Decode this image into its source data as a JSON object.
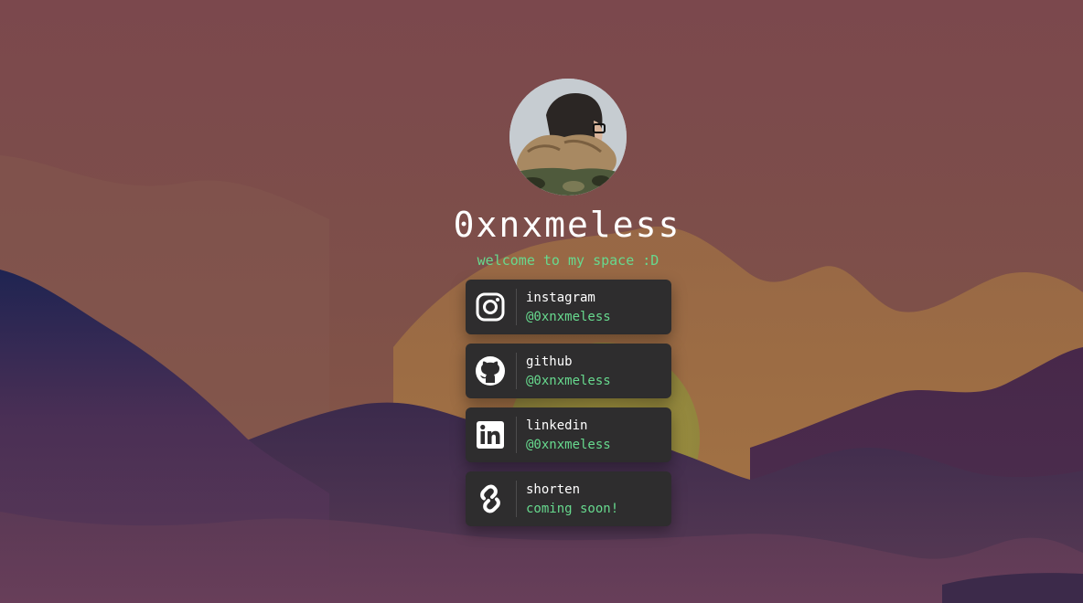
{
  "profile": {
    "name": "0xnxmeless",
    "tagline": "welcome to my space :D"
  },
  "links": [
    {
      "name": "instagram",
      "handle": "@0xnxmeless",
      "icon": "instagram-icon"
    },
    {
      "name": "github",
      "handle": "@0xnxmeless",
      "icon": "github-icon"
    },
    {
      "name": "linkedin",
      "handle": "@0xnxmeless",
      "icon": "linkedin-icon"
    },
    {
      "name": "shorten",
      "handle": "coming soon!",
      "icon": "chain-link-icon"
    }
  ],
  "colors": {
    "accent": "#67d98e",
    "card": "#2e2d2e",
    "sky": "#7b4a4e",
    "title": "#ffffff"
  }
}
